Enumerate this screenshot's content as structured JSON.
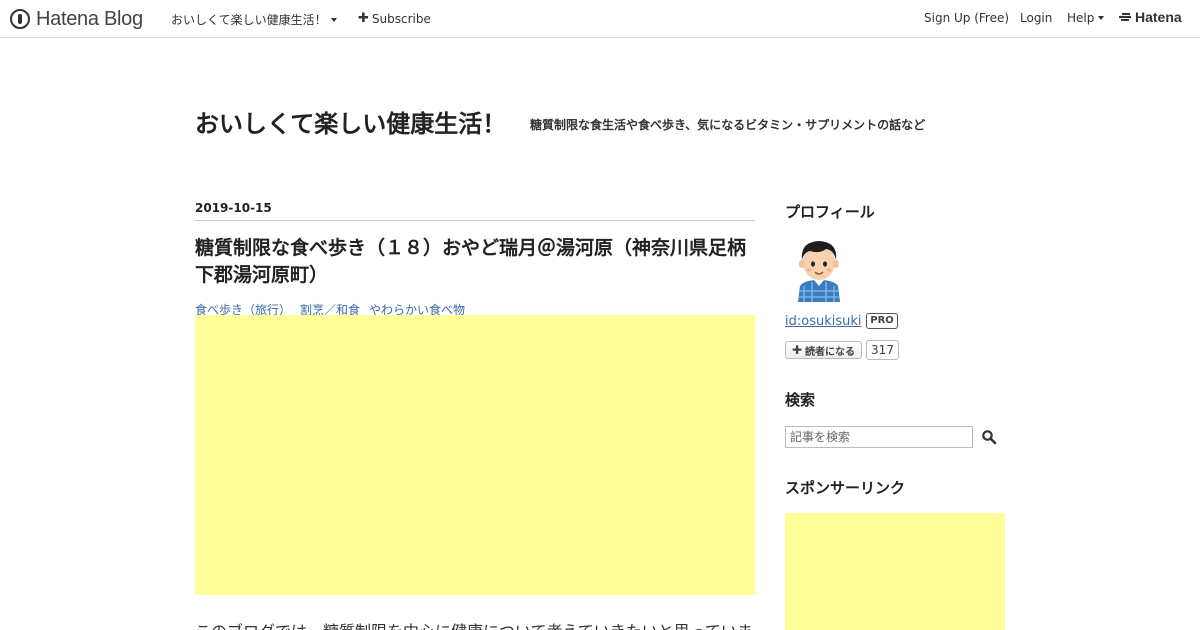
{
  "topbar": {
    "logo_text": "Hatena Blog",
    "blog_menu_label": "おいしくて楽しい健康生活！",
    "subscribe_label": "Subscribe",
    "signup_label": "Sign Up (Free)",
    "login_label": "Login",
    "help_label": "Help",
    "hatena_label": "Hatena"
  },
  "header": {
    "title": "おいしくて楽しい健康生活！",
    "description": "糖質制限な食生活や食べ歩き、気になるビタミン・サプリメントの話など"
  },
  "entry": {
    "date": "2019-10-15",
    "title": "糖質制限な食べ歩き（１８）おやど瑞月＠湯河原（神奈川県足柄下郡湯河原町）",
    "categories": [
      "食べ歩き（旅行）",
      "割烹／和食",
      "やわらかい食べ物"
    ],
    "body_intro": "このブログでは、糖質制限を中心に健康について考えていきたいと思っていま"
  },
  "sidebar": {
    "profile_heading": "プロフィール",
    "profile_id": "id:osukisuki",
    "pro_badge": "PRO",
    "reader_button": "読者になる",
    "reader_count": "317",
    "search_heading": "検索",
    "search_placeholder": "記事を検索",
    "sponsor_heading": "スポンサーリンク"
  },
  "colors": {
    "ad_placeholder": "#ffff99",
    "link": "#3d6ba8"
  }
}
